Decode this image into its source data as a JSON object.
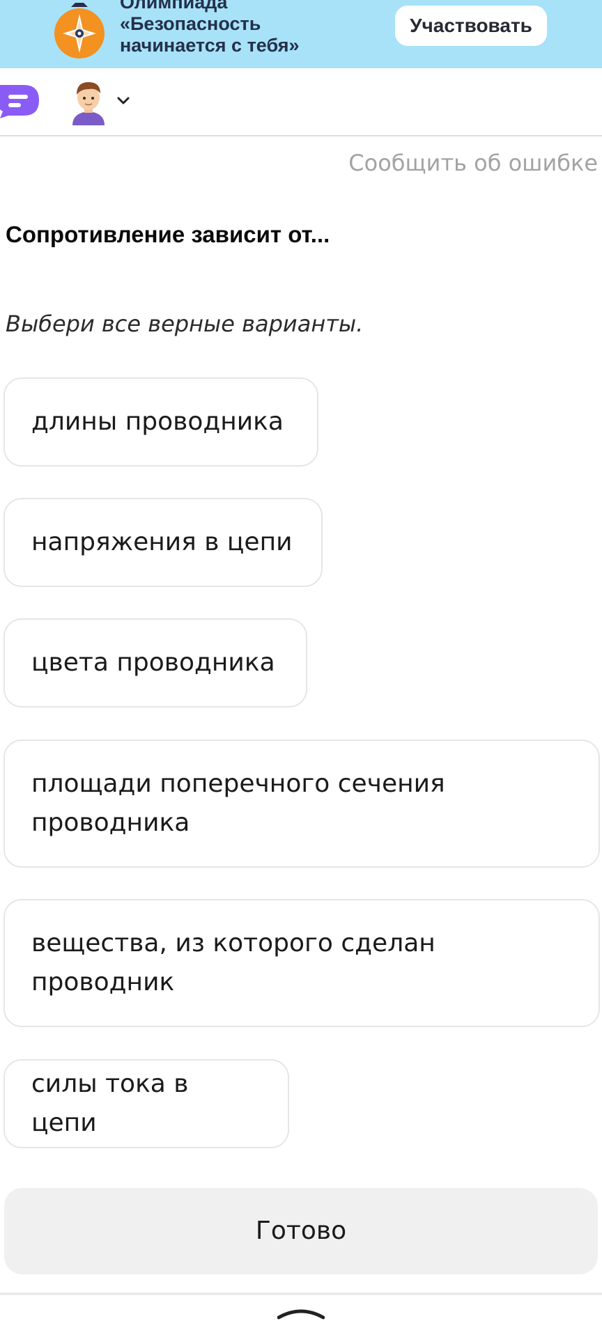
{
  "banner": {
    "title_line_1": "Олимпиада",
    "title_line_2": "«Безопасность",
    "title_line_3": "начинается с тебя»",
    "participate_label": "Участвовать",
    "emblem_icon": "olympiad-star-emblem-icon",
    "background_color": "#a7e2f8",
    "emblem_color": "#f39121"
  },
  "topbar": {
    "chat_icon": "chat-bubble-icon",
    "chat_color": "#8a5cf6",
    "avatar_icon": "boy-avatar-icon",
    "chevron_icon": "chevron-down-icon"
  },
  "report_error_label": "Сообщить об ошибке",
  "question": {
    "title": "Сопротивление зависит от...",
    "hint": "Выбери все верные варианты."
  },
  "options": [
    {
      "label": "длины проводника"
    },
    {
      "label": "напряжения в цепи"
    },
    {
      "label": "цвета проводника"
    },
    {
      "label": "площади поперечного сечения проводника"
    },
    {
      "label": "вещества, из которого сделан проводник"
    },
    {
      "label": "силы тока в цепи"
    }
  ],
  "done_label": "Готово",
  "bottom_handle_icon": "chevron-up-icon"
}
